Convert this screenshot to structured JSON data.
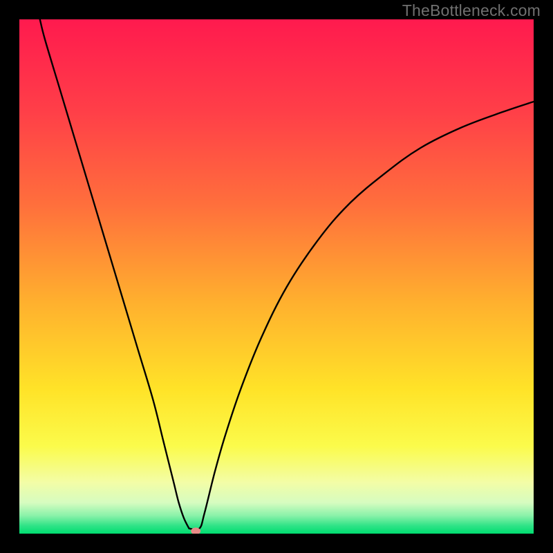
{
  "watermark": "TheBottleneck.com",
  "chart_data": {
    "type": "line",
    "title": "",
    "xlabel": "",
    "ylabel": "",
    "xlim": [
      0,
      100
    ],
    "ylim": [
      0,
      100
    ],
    "minimum_x": 33,
    "gradient_stops": [
      {
        "offset": 0,
        "color": "#ff1a4e"
      },
      {
        "offset": 18,
        "color": "#ff3f48"
      },
      {
        "offset": 36,
        "color": "#ff6f3c"
      },
      {
        "offset": 55,
        "color": "#ffb02e"
      },
      {
        "offset": 72,
        "color": "#ffe328"
      },
      {
        "offset": 83,
        "color": "#fbfb4b"
      },
      {
        "offset": 90,
        "color": "#f3fda6"
      },
      {
        "offset": 94,
        "color": "#d6fcc0"
      },
      {
        "offset": 96.5,
        "color": "#8af2a9"
      },
      {
        "offset": 98.5,
        "color": "#2ee386"
      },
      {
        "offset": 100,
        "color": "#00dd70"
      }
    ],
    "left_branch": [
      {
        "x": 4,
        "y": 100
      },
      {
        "x": 5,
        "y": 96
      },
      {
        "x": 8,
        "y": 86
      },
      {
        "x": 11,
        "y": 76
      },
      {
        "x": 14,
        "y": 66
      },
      {
        "x": 17,
        "y": 56
      },
      {
        "x": 20,
        "y": 46
      },
      {
        "x": 23,
        "y": 36
      },
      {
        "x": 26,
        "y": 26
      },
      {
        "x": 28,
        "y": 18
      },
      {
        "x": 30,
        "y": 10
      },
      {
        "x": 31,
        "y": 6
      },
      {
        "x": 32,
        "y": 3
      },
      {
        "x": 33,
        "y": 1
      }
    ],
    "right_branch": [
      {
        "x": 33,
        "y": 1
      },
      {
        "x": 35,
        "y": 1
      },
      {
        "x": 36,
        "y": 4
      },
      {
        "x": 38,
        "y": 12
      },
      {
        "x": 40,
        "y": 19
      },
      {
        "x": 43,
        "y": 28
      },
      {
        "x": 47,
        "y": 38
      },
      {
        "x": 52,
        "y": 48
      },
      {
        "x": 58,
        "y": 57
      },
      {
        "x": 64,
        "y": 64
      },
      {
        "x": 71,
        "y": 70
      },
      {
        "x": 78,
        "y": 75
      },
      {
        "x": 86,
        "y": 79
      },
      {
        "x": 94,
        "y": 82
      },
      {
        "x": 100,
        "y": 84
      }
    ],
    "marker": {
      "x": 34.3,
      "y": 0.5,
      "color": "#e88b87",
      "radius": 7
    }
  }
}
